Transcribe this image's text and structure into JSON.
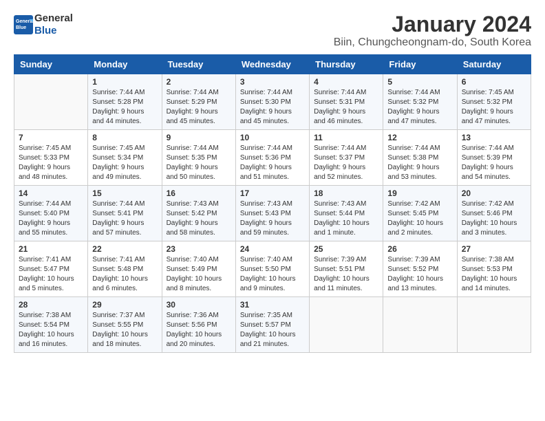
{
  "header": {
    "logo_line1": "General",
    "logo_line2": "Blue",
    "month_year": "January 2024",
    "location": "Biin, Chungcheongnam-do, South Korea"
  },
  "days_of_week": [
    "Sunday",
    "Monday",
    "Tuesday",
    "Wednesday",
    "Thursday",
    "Friday",
    "Saturday"
  ],
  "weeks": [
    [
      {
        "num": "",
        "sunrise": "",
        "sunset": "",
        "daylight": ""
      },
      {
        "num": "1",
        "sunrise": "Sunrise: 7:44 AM",
        "sunset": "Sunset: 5:28 PM",
        "daylight": "Daylight: 9 hours and 44 minutes."
      },
      {
        "num": "2",
        "sunrise": "Sunrise: 7:44 AM",
        "sunset": "Sunset: 5:29 PM",
        "daylight": "Daylight: 9 hours and 45 minutes."
      },
      {
        "num": "3",
        "sunrise": "Sunrise: 7:44 AM",
        "sunset": "Sunset: 5:30 PM",
        "daylight": "Daylight: 9 hours and 45 minutes."
      },
      {
        "num": "4",
        "sunrise": "Sunrise: 7:44 AM",
        "sunset": "Sunset: 5:31 PM",
        "daylight": "Daylight: 9 hours and 46 minutes."
      },
      {
        "num": "5",
        "sunrise": "Sunrise: 7:44 AM",
        "sunset": "Sunset: 5:32 PM",
        "daylight": "Daylight: 9 hours and 47 minutes."
      },
      {
        "num": "6",
        "sunrise": "Sunrise: 7:45 AM",
        "sunset": "Sunset: 5:32 PM",
        "daylight": "Daylight: 9 hours and 47 minutes."
      }
    ],
    [
      {
        "num": "7",
        "sunrise": "Sunrise: 7:45 AM",
        "sunset": "Sunset: 5:33 PM",
        "daylight": "Daylight: 9 hours and 48 minutes."
      },
      {
        "num": "8",
        "sunrise": "Sunrise: 7:45 AM",
        "sunset": "Sunset: 5:34 PM",
        "daylight": "Daylight: 9 hours and 49 minutes."
      },
      {
        "num": "9",
        "sunrise": "Sunrise: 7:44 AM",
        "sunset": "Sunset: 5:35 PM",
        "daylight": "Daylight: 9 hours and 50 minutes."
      },
      {
        "num": "10",
        "sunrise": "Sunrise: 7:44 AM",
        "sunset": "Sunset: 5:36 PM",
        "daylight": "Daylight: 9 hours and 51 minutes."
      },
      {
        "num": "11",
        "sunrise": "Sunrise: 7:44 AM",
        "sunset": "Sunset: 5:37 PM",
        "daylight": "Daylight: 9 hours and 52 minutes."
      },
      {
        "num": "12",
        "sunrise": "Sunrise: 7:44 AM",
        "sunset": "Sunset: 5:38 PM",
        "daylight": "Daylight: 9 hours and 53 minutes."
      },
      {
        "num": "13",
        "sunrise": "Sunrise: 7:44 AM",
        "sunset": "Sunset: 5:39 PM",
        "daylight": "Daylight: 9 hours and 54 minutes."
      }
    ],
    [
      {
        "num": "14",
        "sunrise": "Sunrise: 7:44 AM",
        "sunset": "Sunset: 5:40 PM",
        "daylight": "Daylight: 9 hours and 55 minutes."
      },
      {
        "num": "15",
        "sunrise": "Sunrise: 7:44 AM",
        "sunset": "Sunset: 5:41 PM",
        "daylight": "Daylight: 9 hours and 57 minutes."
      },
      {
        "num": "16",
        "sunrise": "Sunrise: 7:43 AM",
        "sunset": "Sunset: 5:42 PM",
        "daylight": "Daylight: 9 hours and 58 minutes."
      },
      {
        "num": "17",
        "sunrise": "Sunrise: 7:43 AM",
        "sunset": "Sunset: 5:43 PM",
        "daylight": "Daylight: 9 hours and 59 minutes."
      },
      {
        "num": "18",
        "sunrise": "Sunrise: 7:43 AM",
        "sunset": "Sunset: 5:44 PM",
        "daylight": "Daylight: 10 hours and 1 minute."
      },
      {
        "num": "19",
        "sunrise": "Sunrise: 7:42 AM",
        "sunset": "Sunset: 5:45 PM",
        "daylight": "Daylight: 10 hours and 2 minutes."
      },
      {
        "num": "20",
        "sunrise": "Sunrise: 7:42 AM",
        "sunset": "Sunset: 5:46 PM",
        "daylight": "Daylight: 10 hours and 3 minutes."
      }
    ],
    [
      {
        "num": "21",
        "sunrise": "Sunrise: 7:41 AM",
        "sunset": "Sunset: 5:47 PM",
        "daylight": "Daylight: 10 hours and 5 minutes."
      },
      {
        "num": "22",
        "sunrise": "Sunrise: 7:41 AM",
        "sunset": "Sunset: 5:48 PM",
        "daylight": "Daylight: 10 hours and 6 minutes."
      },
      {
        "num": "23",
        "sunrise": "Sunrise: 7:40 AM",
        "sunset": "Sunset: 5:49 PM",
        "daylight": "Daylight: 10 hours and 8 minutes."
      },
      {
        "num": "24",
        "sunrise": "Sunrise: 7:40 AM",
        "sunset": "Sunset: 5:50 PM",
        "daylight": "Daylight: 10 hours and 9 minutes."
      },
      {
        "num": "25",
        "sunrise": "Sunrise: 7:39 AM",
        "sunset": "Sunset: 5:51 PM",
        "daylight": "Daylight: 10 hours and 11 minutes."
      },
      {
        "num": "26",
        "sunrise": "Sunrise: 7:39 AM",
        "sunset": "Sunset: 5:52 PM",
        "daylight": "Daylight: 10 hours and 13 minutes."
      },
      {
        "num": "27",
        "sunrise": "Sunrise: 7:38 AM",
        "sunset": "Sunset: 5:53 PM",
        "daylight": "Daylight: 10 hours and 14 minutes."
      }
    ],
    [
      {
        "num": "28",
        "sunrise": "Sunrise: 7:38 AM",
        "sunset": "Sunset: 5:54 PM",
        "daylight": "Daylight: 10 hours and 16 minutes."
      },
      {
        "num": "29",
        "sunrise": "Sunrise: 7:37 AM",
        "sunset": "Sunset: 5:55 PM",
        "daylight": "Daylight: 10 hours and 18 minutes."
      },
      {
        "num": "30",
        "sunrise": "Sunrise: 7:36 AM",
        "sunset": "Sunset: 5:56 PM",
        "daylight": "Daylight: 10 hours and 20 minutes."
      },
      {
        "num": "31",
        "sunrise": "Sunrise: 7:35 AM",
        "sunset": "Sunset: 5:57 PM",
        "daylight": "Daylight: 10 hours and 21 minutes."
      },
      {
        "num": "",
        "sunrise": "",
        "sunset": "",
        "daylight": ""
      },
      {
        "num": "",
        "sunrise": "",
        "sunset": "",
        "daylight": ""
      },
      {
        "num": "",
        "sunrise": "",
        "sunset": "",
        "daylight": ""
      }
    ]
  ]
}
